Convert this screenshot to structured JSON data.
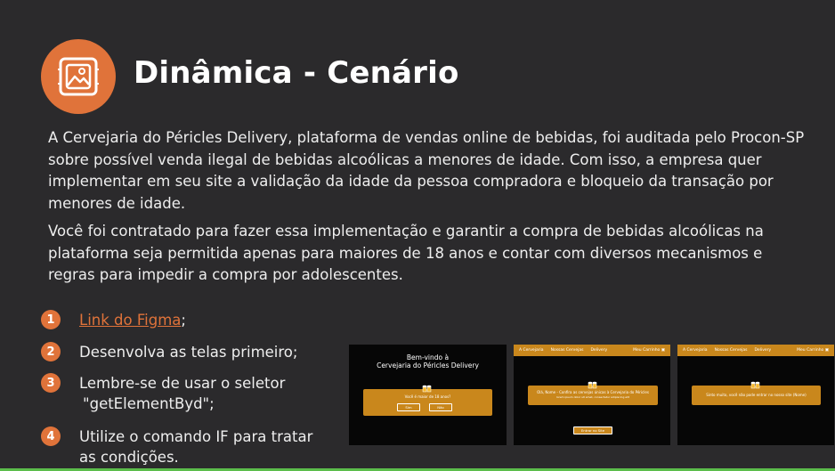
{
  "title": "Dinâmica - Cenário",
  "paragraphs": [
    "A Cervejaria do Péricles Delivery, plataforma de vendas online de bebidas, foi auditada pelo Procon-SP sobre possível venda ilegal de bebidas alcoólicas a menores de idade. Com isso, a empresa quer implementar em seu site a validação da idade da pessoa compradora e bloqueio da transação por menores de idade.",
    "Você foi contratado para fazer essa implementação e garantir a compra de bebidas alcoólicas na plataforma seja permitida apenas para maiores de 18 anos e contar com diversos mecanismos e regras para impedir a compra por adolescentes."
  ],
  "steps": [
    {
      "num": "1",
      "link": "Link do Figma",
      "suffix": ";"
    },
    {
      "num": "2",
      "text": "Desenvolva as telas primeiro;"
    },
    {
      "num": "3",
      "line1": "Lembre-se de usar o seletor",
      "line2": "\"getElementByd\";"
    },
    {
      "num": "4",
      "line1": "Utilize o comando IF para tratar",
      "line2": "as condições."
    }
  ],
  "screens": {
    "s1": {
      "welcome_line1": "Bem-vindo à",
      "welcome_line2": "Cervejaria do Péricles Delivery",
      "question": "Você é maior de 18 anos?",
      "yes": "Sim",
      "no": "Não"
    },
    "s2": {
      "nav_left": [
        "A Cervejaria",
        "Nossas Cervejas",
        "Delivery"
      ],
      "nav_right": "Meu Carrinho ▣",
      "message": "Olá, Nome - Confira as cervejas únicas à Cervejaria do Péricles",
      "sub": "lorem ipsum dolor sit amet, consectetur adipiscing elit",
      "button": "Entrar no Site"
    },
    "s3": {
      "nav_left": [
        "A Cervejaria",
        "Nossas Cervejas",
        "Delivery"
      ],
      "nav_right": "Meu Carrinho ▣",
      "message": "Sinto muito, você não pode entrar no nosso site (Nome)"
    }
  },
  "colors": {
    "accent": "#e0733a",
    "background": "#2b2a2c",
    "mockup_orange": "#c9871c",
    "bottom_bar": "#5bbd4b"
  },
  "icons": {
    "logo": "image-gallery-icon"
  }
}
